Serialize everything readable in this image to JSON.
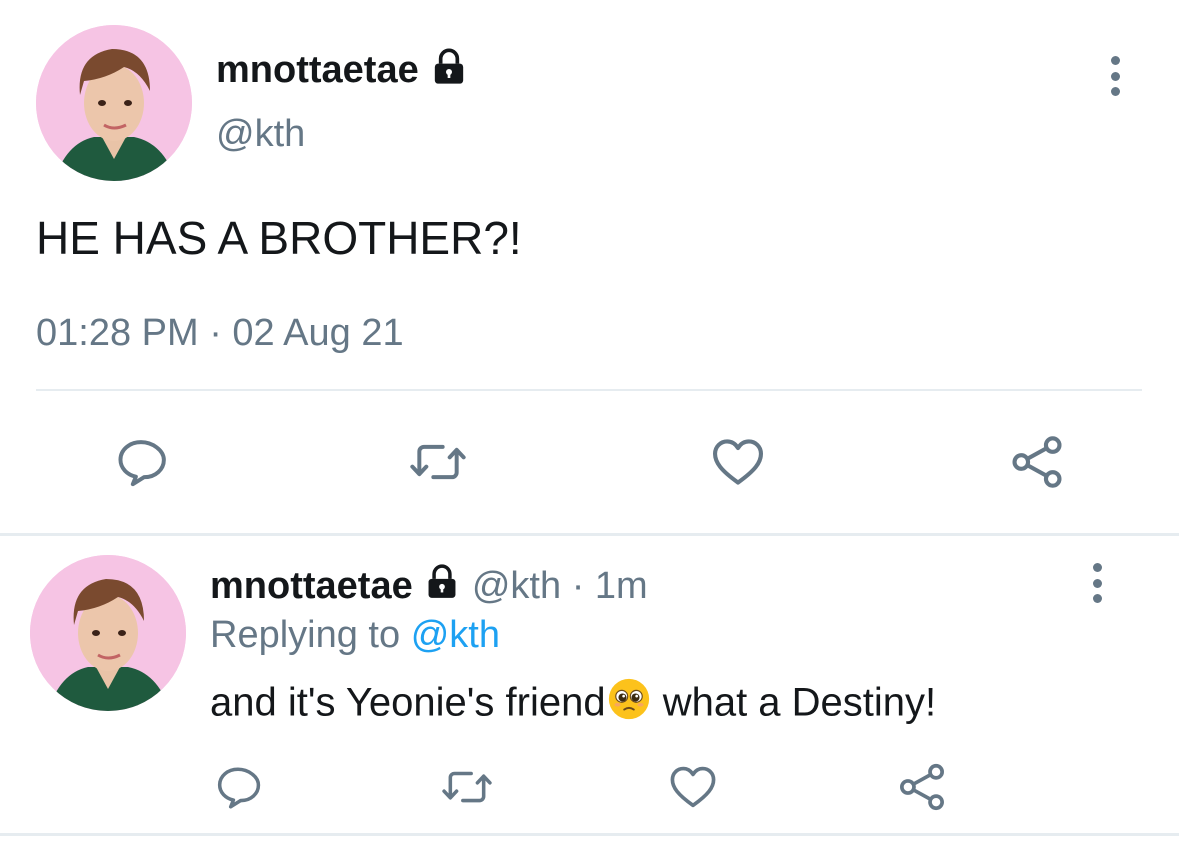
{
  "main_tweet": {
    "display_name": "mnottaetae",
    "handle": "@kth",
    "text": "HE HAS A BROTHER?!",
    "timestamp": "01:28 PM · 02 Aug 21",
    "icons": [
      "lock-icon",
      "more-vert-icon",
      "reply-icon",
      "retweet-icon",
      "like-icon",
      "share-icon"
    ]
  },
  "reply_tweet": {
    "display_name": "mnottaetae",
    "handle": "@kth",
    "age": "· 1m",
    "replying_prefix": "Replying to",
    "replying_handle": "@kth",
    "text_before_emoji": "and it's Yeonie's friend",
    "emoji": "pleading-face-emoji",
    "text_after_emoji": " what a Destiny!",
    "icons": [
      "lock-icon",
      "more-vert-icon",
      "reply-icon",
      "retweet-icon",
      "like-icon",
      "share-icon"
    ]
  },
  "colors": {
    "text": "#14171a",
    "muted": "#657786",
    "link": "#1da1f2",
    "divider": "#e6ecf0",
    "avatar_bg": "#f6c4e4"
  }
}
